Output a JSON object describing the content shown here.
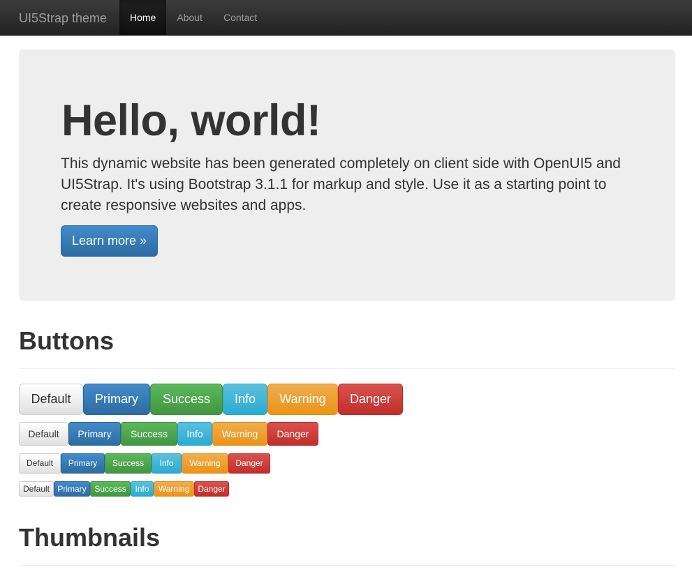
{
  "navbar": {
    "brand": "UI5Strap theme",
    "items": [
      {
        "label": "Home",
        "active": true
      },
      {
        "label": "About",
        "active": false
      },
      {
        "label": "Contact",
        "active": false
      }
    ]
  },
  "jumbotron": {
    "heading": "Hello, world!",
    "text": "This dynamic website has been generated completely on client side with OpenUI5 and UI5Strap. It's using Bootstrap 3.1.1 for markup and style. Use it as a starting point to create responsive websites and apps.",
    "button_label": "Learn more »"
  },
  "buttons_section": {
    "title": "Buttons",
    "labels": [
      "Default",
      "Primary",
      "Success",
      "Info",
      "Warning",
      "Danger"
    ]
  },
  "thumbnails_section": {
    "title": "Thumbnails"
  },
  "colors": {
    "primary": "#428bca",
    "success": "#5cb85c",
    "info": "#5bc0de",
    "warning": "#f0ad4e",
    "danger": "#d9534f",
    "navbar": "#222222",
    "jumbotron_bg": "#eeeeee"
  }
}
